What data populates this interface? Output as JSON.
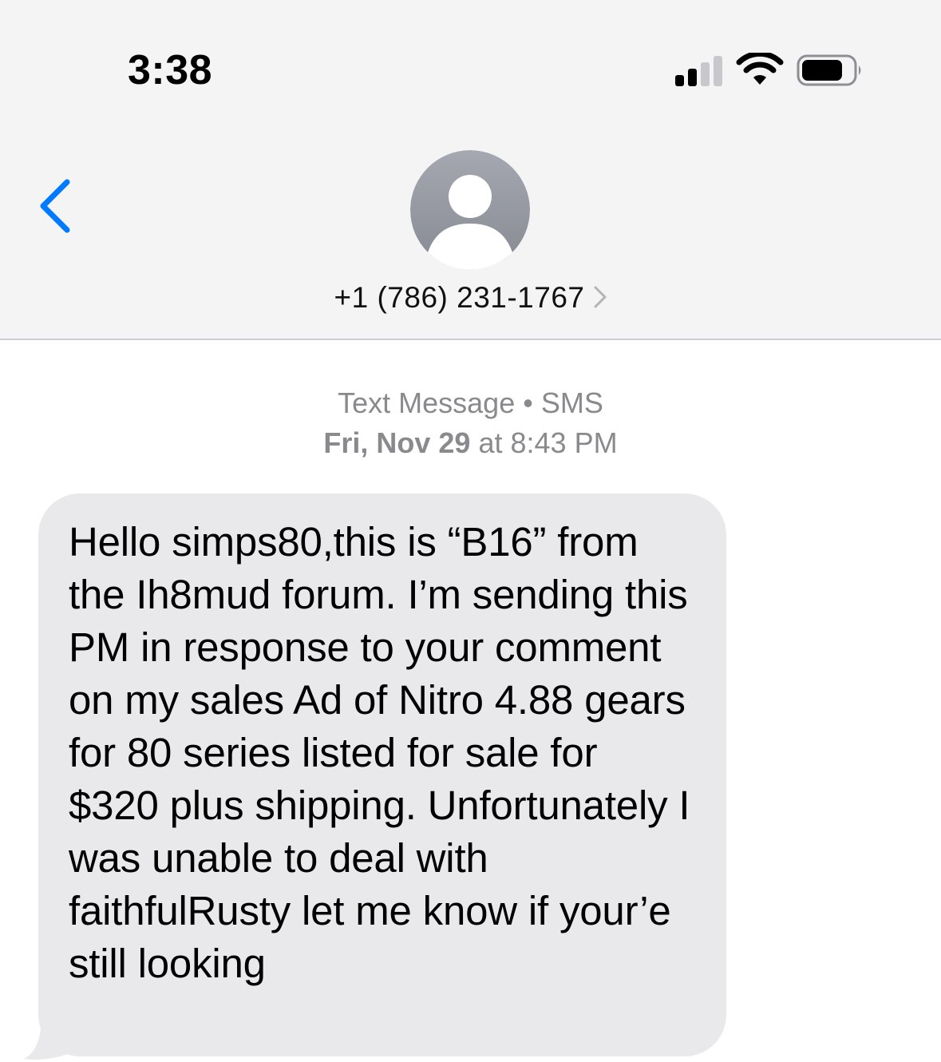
{
  "status_bar": {
    "time": "3:38",
    "signal_icon": "cellular-signal-icon",
    "wifi_icon": "wifi-icon",
    "battery_icon": "battery-icon"
  },
  "header": {
    "back_icon": "chevron-left-icon",
    "avatar_icon": "person-silhouette-icon",
    "contact_name": "+1 (786) 231-1767",
    "contact_chevron_icon": "chevron-right-icon",
    "accent_color": "#007aff"
  },
  "conversation": {
    "service_label": "Text Message",
    "service_separator": "•",
    "service_type": "SMS",
    "date_prefix": "Fri, Nov 29",
    "date_at": "at",
    "time": "8:43 PM",
    "messages": [
      {
        "direction": "incoming",
        "bubble_color": "#e9e9eb",
        "text": "Hello simps80,this is “B16” from the Ih8mud forum. I’m sending this PM in response to your comment on my sales Ad of Nitro 4.88 gears for 80 series listed for sale for $320 plus shipping. Unfortunately I was unable to deal with faithfulRusty let me know if your’e still looking"
      }
    ]
  }
}
